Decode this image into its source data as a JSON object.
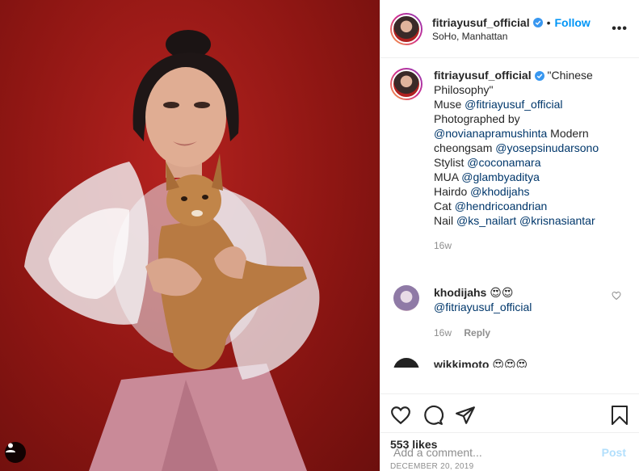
{
  "post": {
    "username": "fitriayusuf_official",
    "separator": "•",
    "follow_label": "Follow",
    "location": "SoHo, Manhattan",
    "more_label": "•••"
  },
  "caption": {
    "username": "fitriayusuf_official",
    "title": "\"Chinese Philosophy\"",
    "line_muse_label": "Muse ",
    "line_muse_mention": "@fitriayusuf_official",
    "line_photo_label": "Photographed by ",
    "line_photo_mention": "@novianapramushinta",
    "line_modern_label": " Modern cheongsam ",
    "line_modern_mention": "@yosepsinudarsono",
    "line_stylist_label": "Stylist ",
    "line_stylist_mention": "@coconamara",
    "line_mua_label": "MUA ",
    "line_mua_mention": "@glambyaditya",
    "line_hair_label": "Hairdo ",
    "line_hair_mention": "@khodijahs",
    "line_cat_label": "Cat ",
    "line_cat_mention": "@hendricoandrian",
    "line_nail_label": "Nail ",
    "line_nail_mention1": "@ks_nailart",
    "line_nail_mention2": "@krisnasiantar",
    "time": "16w"
  },
  "comments": [
    {
      "username": "khodijahs",
      "emoji": "😍😍",
      "text": "@fitriayusuf_official",
      "time": "16w",
      "reply_label": "Reply"
    },
    {
      "username": "wikkimoto",
      "emoji": "😍😍😍"
    }
  ],
  "engagement": {
    "likes": "553 likes",
    "date": "DECEMBER 20, 2019"
  },
  "add_comment": {
    "placeholder": "Add a comment...",
    "post_label": "Post"
  }
}
